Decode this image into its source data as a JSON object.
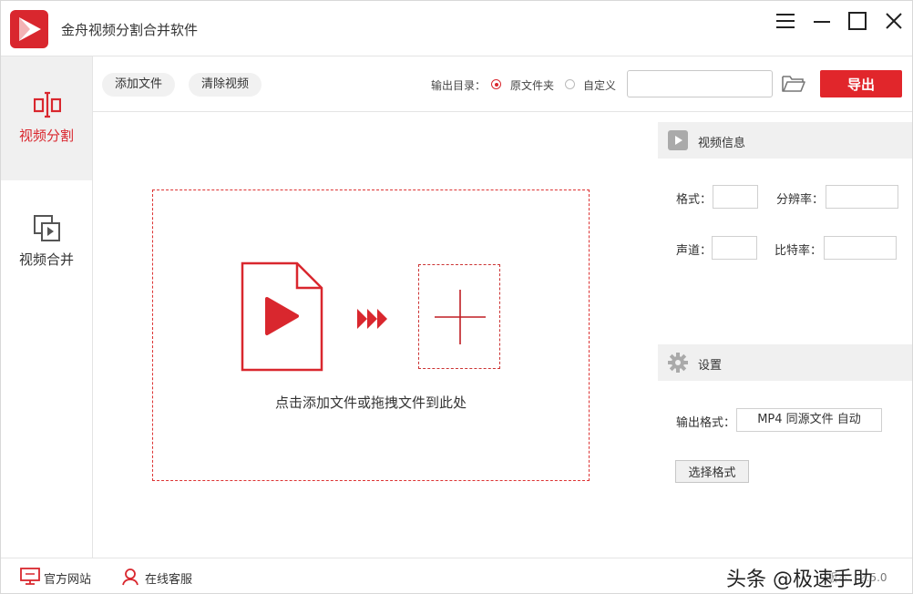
{
  "app": {
    "title": "金舟视频分割合并软件",
    "accent_color": "#d9272e"
  },
  "window_controls": {
    "menu_icon": "menu-icon",
    "minimize_icon": "minimize-icon",
    "maximize_icon": "maximize-icon",
    "close_icon": "close-icon"
  },
  "sidebar": {
    "items": [
      {
        "label": "视频分割",
        "icon": "split-icon",
        "active": true
      },
      {
        "label": "视频合并",
        "icon": "merge-icon",
        "active": false
      }
    ]
  },
  "toolbar": {
    "add_file_label": "添加文件",
    "clear_video_label": "清除视频",
    "output_dir_label": "输出目录：",
    "radio_original_label": "原文件夹",
    "radio_custom_label": "自定义",
    "selected_output": "原文件夹",
    "path_value": "",
    "path_placeholder": "",
    "folder_icon": "folder-open-icon",
    "export_label": "导出"
  },
  "dropzone": {
    "hint": "点击添加文件或拖拽文件到此处",
    "file_icon": "video-file-icon",
    "arrows_icon": "triple-arrow-icon",
    "plus_icon": "plus-icon"
  },
  "video_info": {
    "title": "视频信息",
    "icon": "video-info-icon",
    "format_label": "格式：",
    "format_value": "",
    "resolution_label": "分辨率：",
    "resolution_value": "",
    "channel_label": "声道：",
    "channel_value": "",
    "bitrate_label": "比特率：",
    "bitrate_value": ""
  },
  "settings": {
    "title": "设置",
    "icon": "gear-icon",
    "output_format_label": "输出格式：",
    "output_format_value": "MP4 同源文件 自动",
    "choose_format_label": "选择格式"
  },
  "footer": {
    "website_label": "官方网站",
    "website_icon": "monitor-icon",
    "support_label": "在线客服",
    "support_icon": "user-icon",
    "version_text": "版本：2.5.0",
    "watermark_text": "头条 @极速手助"
  }
}
